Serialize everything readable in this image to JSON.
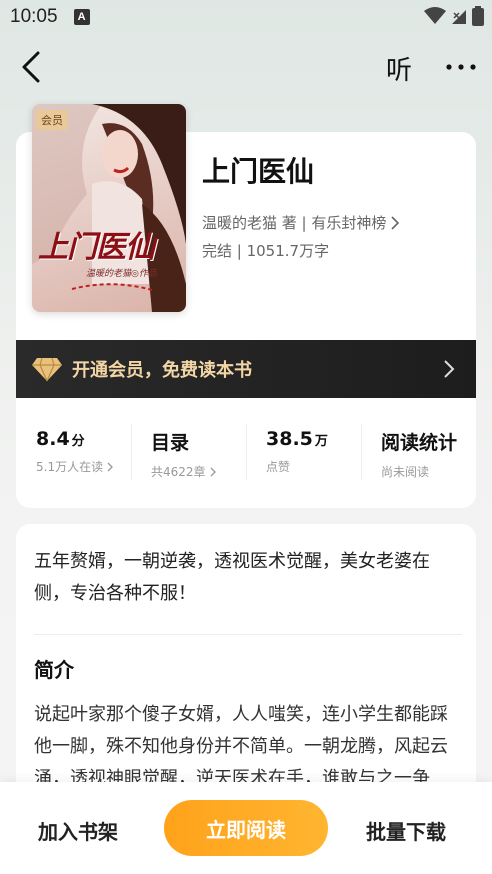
{
  "status_bar": {
    "time": "10:05",
    "notification_badge": "A"
  },
  "header": {
    "listen_label": "听"
  },
  "book": {
    "cover_badge": "会员",
    "cover_title": "上门医仙",
    "cover_author": "温暖的老猫◎作品",
    "title": "上门医仙",
    "author_line": "温暖的老猫 著 | 有乐封神榜",
    "status_line": "完结 | 1051.7万字"
  },
  "vip_banner": {
    "text": "开通会员，免费读本书"
  },
  "stats": [
    {
      "main": "8.4",
      "unit": "分",
      "sub": "5.1万人在读",
      "has_arrow": true
    },
    {
      "main": "目录",
      "unit": "",
      "sub": "共4622章",
      "has_arrow": true
    },
    {
      "main": "38.5",
      "unit": "万",
      "sub": "点赞",
      "has_arrow": false
    },
    {
      "main": "阅读统计",
      "unit": "",
      "sub": "尚未阅读",
      "has_arrow": false
    }
  ],
  "intro": {
    "tagline": "五年赘婿，一朝逆袭，透视医术觉醒，美女老婆在侧，专治各种不服！",
    "heading": "简介",
    "text": "说起叶家那个傻子女婿，人人嗤笑，连小学生都能踩他一脚，殊不知他身份并不简单。一朝龙腾，风起云涌，透视神眼觉醒，逆天医术在手，谁敢与之一争"
  },
  "bottom_bar": {
    "shelf_label": "加入书架",
    "read_label": "立即阅读",
    "download_label": "批量下载"
  },
  "colors": {
    "accent_orange": "#ffa21a",
    "vip_gold": "#f2d6a5",
    "vip_bg": "#1d1d1d"
  }
}
